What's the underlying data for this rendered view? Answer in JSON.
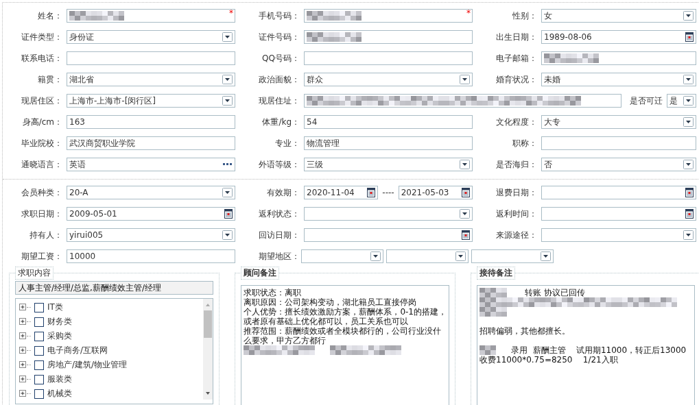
{
  "sections": [
    {
      "rows": [
        {
          "items": [
            {
              "label": "姓名：",
              "fields": [
                {
                  "kind": "text",
                  "blurred": true,
                  "required_mark": "*"
                }
              ]
            },
            {
              "label": "手机号码：",
              "fields": [
                {
                  "kind": "text",
                  "blurred": true,
                  "required_mark": "*"
                }
              ]
            },
            {
              "label": "性别：",
              "fields": [
                {
                  "kind": "select",
                  "value": "女"
                }
              ]
            }
          ]
        },
        {
          "items": [
            {
              "label": "证件类型：",
              "fields": [
                {
                  "kind": "select",
                  "value": "身份证"
                }
              ]
            },
            {
              "label": "证件号码：",
              "fields": [
                {
                  "kind": "text",
                  "blurred": true
                }
              ]
            },
            {
              "label": "出生日期：",
              "fields": [
                {
                  "kind": "date",
                  "value": "1989-08-06"
                }
              ]
            }
          ]
        },
        {
          "items": [
            {
              "label": "联系电话：",
              "fields": [
                {
                  "kind": "text"
                }
              ]
            },
            {
              "label": "QQ号码：",
              "fields": [
                {
                  "kind": "text"
                }
              ]
            },
            {
              "label": "电子邮箱：",
              "fields": [
                {
                  "kind": "text",
                  "blurred": true
                }
              ]
            }
          ]
        },
        {
          "items": [
            {
              "label": "籍贯：",
              "fields": [
                {
                  "kind": "select",
                  "value": "湖北省"
                }
              ]
            },
            {
              "label": "政治面貌：",
              "fields": [
                {
                  "kind": "select",
                  "value": "群众"
                }
              ]
            },
            {
              "label": "婚育状况：",
              "fields": [
                {
                  "kind": "select",
                  "value": "未婚"
                }
              ]
            }
          ]
        },
        {
          "items": [
            {
              "label": "现居住区：",
              "fields": [
                {
                  "kind": "select",
                  "value": "上海市-上海市-[闵行区]"
                }
              ]
            },
            {
              "label": "现居住址：",
              "wide": true,
              "fields": [
                {
                  "kind": "text",
                  "blurred": true
                },
                {
                  "kind": "inline-label",
                  "value": "是否可迁"
                },
                {
                  "kind": "mini-select",
                  "value": "是"
                }
              ]
            }
          ]
        },
        {
          "items": [
            {
              "label": "身高/cm：",
              "fields": [
                {
                  "kind": "text",
                  "value": "163"
                }
              ]
            },
            {
              "label": "体重/kg：",
              "fields": [
                {
                  "kind": "text",
                  "value": "54"
                }
              ]
            },
            {
              "label": "文化程度：",
              "fields": [
                {
                  "kind": "select",
                  "value": "大专"
                }
              ]
            }
          ]
        },
        {
          "items": [
            {
              "label": "毕业院校：",
              "fields": [
                {
                  "kind": "text",
                  "value": "武汉商贸职业学院"
                }
              ]
            },
            {
              "label": "专业：",
              "fields": [
                {
                  "kind": "text",
                  "value": "物流管理"
                }
              ]
            },
            {
              "label": "职称：",
              "fields": [
                {
                  "kind": "text"
                }
              ]
            }
          ]
        },
        {
          "items": [
            {
              "label": "通晓语言：",
              "fields": [
                {
                  "kind": "lookup",
                  "value": "英语"
                }
              ]
            },
            {
              "label": "外语等级：",
              "fields": [
                {
                  "kind": "select",
                  "value": "三级"
                }
              ]
            },
            {
              "label": "是否海归：",
              "fields": [
                {
                  "kind": "select",
                  "value": "否"
                }
              ]
            }
          ]
        }
      ]
    },
    {
      "rows": [
        {
          "items": [
            {
              "label": "会员种类：",
              "fields": [
                {
                  "kind": "select",
                  "value": "20-A"
                }
              ]
            },
            {
              "label": "有效期：",
              "fields": [
                {
                  "kind": "date",
                  "value": "2020-11-04"
                },
                {
                  "kind": "dash",
                  "value": "----"
                },
                {
                  "kind": "date",
                  "value": "2021-05-03"
                }
              ]
            },
            {
              "label": "退费日期：",
              "fields": [
                {
                  "kind": "date"
                }
              ]
            }
          ]
        },
        {
          "items": [
            {
              "label": "求职日期：",
              "fields": [
                {
                  "kind": "date",
                  "value": "2009-05-01"
                }
              ]
            },
            {
              "label": "返利状态：",
              "fields": [
                {
                  "kind": "select"
                }
              ]
            },
            {
              "label": "返利时间：",
              "fields": [
                {
                  "kind": "date"
                }
              ]
            }
          ]
        },
        {
          "items": [
            {
              "label": "持有人：",
              "fields": [
                {
                  "kind": "select",
                  "value": "yirui005"
                }
              ]
            },
            {
              "label": "回访日期：",
              "fields": [
                {
                  "kind": "date"
                }
              ]
            },
            {
              "label": "来源途径：",
              "fields": [
                {
                  "kind": "select"
                }
              ]
            }
          ]
        },
        {
          "items": [
            {
              "label": "期望工资：",
              "fields": [
                {
                  "kind": "text",
                  "value": "10000"
                }
              ]
            },
            {
              "label": "期望地区：",
              "wide": true,
              "fields": [
                {
                  "kind": "fixed-select"
                },
                {
                  "kind": "fixed-select"
                },
                {
                  "kind": "fixed-select"
                }
              ]
            }
          ]
        }
      ]
    }
  ],
  "job_panel": {
    "title": "求职内容",
    "summary": "人事主管/经理/总监,薪酬绩效主管/经理",
    "tree": [
      {
        "label": "IT类",
        "checked": false,
        "expanded": false
      },
      {
        "label": "财务类",
        "checked": false,
        "expanded": false
      },
      {
        "label": "采购类",
        "checked": false,
        "expanded": false
      },
      {
        "label": "电子商务/互联网",
        "checked": false,
        "expanded": false
      },
      {
        "label": "房地产/建筑/物业管理",
        "checked": false,
        "expanded": false
      },
      {
        "label": "服装类",
        "checked": false,
        "expanded": false
      },
      {
        "label": "机械类",
        "checked": false,
        "expanded": false
      }
    ]
  },
  "note_panels": [
    {
      "title": "顾问备注",
      "lines": [
        {
          "segments": [
            {
              "kind": "text",
              "text": "求职状态：离职"
            }
          ]
        },
        {
          "segments": [
            {
              "kind": "text",
              "text": "离职原因：公司架构变动，湖北籍员工直接停岗"
            }
          ]
        },
        {
          "segments": [
            {
              "kind": "text",
              "text": "个人优势：擅长绩效激励方案，薪酬体系，0-1的搭建，"
            }
          ]
        },
        {
          "segments": [
            {
              "kind": "text",
              "text": "或者原有基础上优化都可以，员工关系也可以"
            }
          ]
        },
        {
          "segments": [
            {
              "kind": "text",
              "text": "推荐范围：薪酬绩效或者全模块都行的，公司行业没什"
            }
          ]
        },
        {
          "segments": [
            {
              "kind": "text",
              "text": "么要求，甲方乙方都行"
            }
          ]
        },
        {
          "segments": [
            {
              "kind": "blur-medium"
            },
            {
              "kind": "blur-medium"
            }
          ]
        }
      ]
    },
    {
      "title": "接待备注",
      "lines": [
        {
          "segments": [
            {
              "kind": "blur-short"
            },
            {
              "kind": "text",
              "text": " 转账 协议已回传"
            }
          ]
        },
        {
          "segments": [
            {
              "kind": "blur-long"
            }
          ]
        },
        {
          "segments": [
            {
              "kind": "blur-short"
            }
          ]
        },
        {
          "kind": "blank"
        },
        {
          "segments": [
            {
              "kind": "text",
              "text": "招聘偏弱，其他都擅长。"
            }
          ]
        },
        {
          "kind": "blank"
        },
        {
          "segments": [
            {
              "kind": "blur-tiny"
            },
            {
              "kind": "text",
              "text": "录用  薪酬主管    试用期11000，转正后13000"
            }
          ]
        },
        {
          "segments": [
            {
              "kind": "text",
              "text": "收费11000*0.75=8250    1/21入职"
            }
          ]
        }
      ]
    }
  ]
}
